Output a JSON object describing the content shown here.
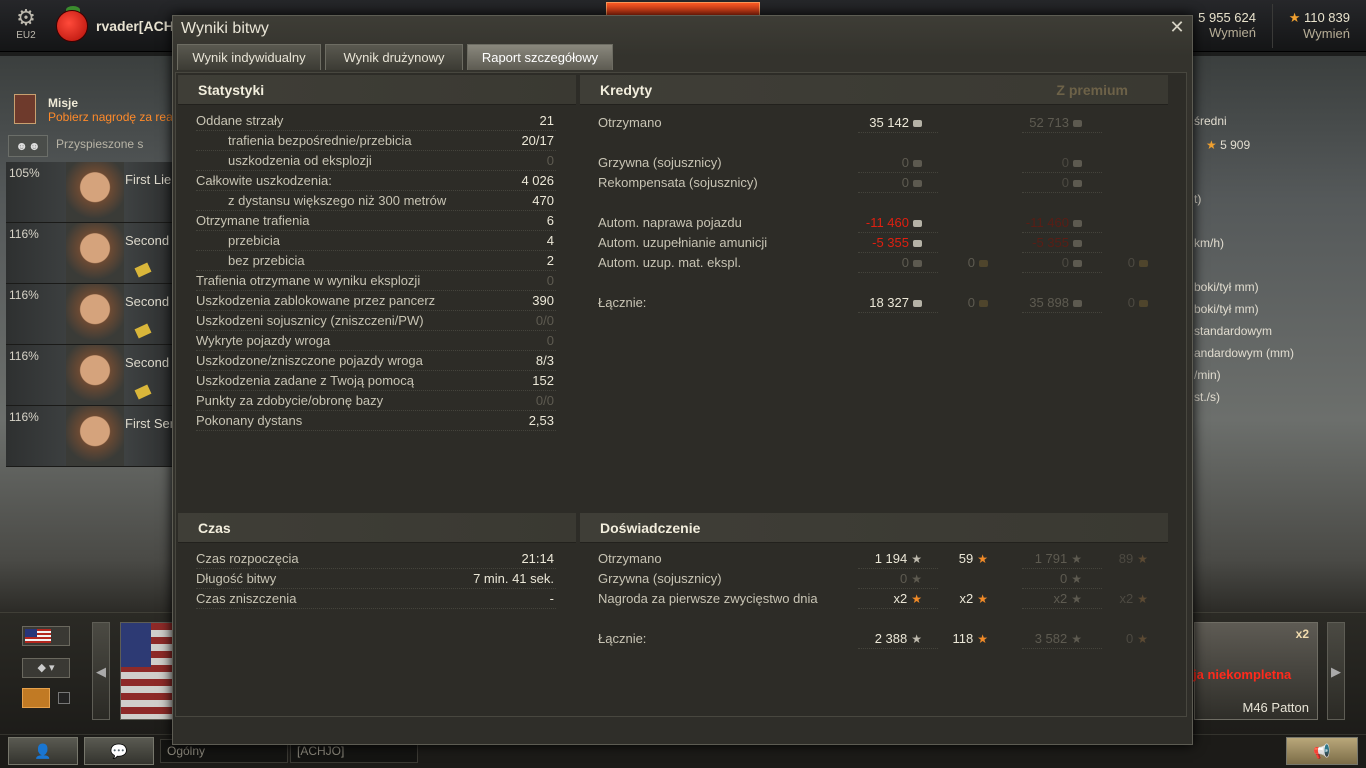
{
  "topbar": {
    "server": "EU2",
    "player": "rvader[ACHJ",
    "credits": "5 955 624",
    "credits_link": "Wymień",
    "freexp": "110 839",
    "freexp_link": "Wymień",
    "freexp_icon": "star-icon"
  },
  "missions": {
    "title": "Misje",
    "subtitle": "Pobierz nagrodę za real"
  },
  "crew_header": {
    "boost_label": "Przyspieszone s"
  },
  "crew": [
    {
      "pct": "105%",
      "rank": "First Lie"
    },
    {
      "pct": "116%",
      "rank": "Second"
    },
    {
      "pct": "116%",
      "rank": "Second"
    },
    {
      "pct": "116%",
      "rank": "Second"
    },
    {
      "pct": "116%",
      "rank": "First Ser"
    }
  ],
  "right_side": {
    "lines": [
      "średni",
      "5 909",
      "t)",
      "km/h)",
      "boki/tył mm)",
      "boki/tył mm)",
      "standardowym",
      "andardowym (mm)",
      "/min)",
      "st./s)"
    ]
  },
  "tank_right": {
    "badge": "x2",
    "warning": "ja niekompletna",
    "name": "M46 Patton"
  },
  "chat": {
    "channel1": "Ogólny",
    "channel2": "[ACHJO]"
  },
  "dialog": {
    "title": "Wyniki bitwy",
    "tabs": [
      "Wynik indywidualny",
      "Wynik drużynowy",
      "Raport szczegółowy"
    ],
    "active_tab": 2
  },
  "stats": {
    "title": "Statystyki",
    "rows": [
      {
        "label": "Oddane strzały",
        "value": "21",
        "indent": false,
        "dim": false
      },
      {
        "label": "trafienia bezpośrednie/przebicia",
        "value": "20/17",
        "indent": true,
        "dim": false
      },
      {
        "label": "uszkodzenia od eksplozji",
        "value": "0",
        "indent": true,
        "dim": true
      },
      {
        "label": "Całkowite uszkodzenia:",
        "value": "4 026",
        "indent": false,
        "dim": false
      },
      {
        "label": "z dystansu większego niż 300 metrów",
        "value": "470",
        "indent": true,
        "dim": false
      },
      {
        "label": "Otrzymane trafienia",
        "value": "6",
        "indent": false,
        "dim": false
      },
      {
        "label": "przebicia",
        "value": "4",
        "indent": true,
        "dim": false
      },
      {
        "label": "bez przebicia",
        "value": "2",
        "indent": true,
        "dim": false
      },
      {
        "label": "Trafienia otrzymane w wyniku eksplozji",
        "value": "0",
        "indent": false,
        "dim": true
      },
      {
        "label": "Uszkodzenia zablokowane przez pancerz",
        "value": "390",
        "indent": false,
        "dim": false
      },
      {
        "label": "Uszkodzeni sojusznicy (zniszczeni/PW)",
        "value": "0/0",
        "indent": false,
        "dim": true
      },
      {
        "label": "Wykryte pojazdy wroga",
        "value": "0",
        "indent": false,
        "dim": true
      },
      {
        "label": "Uszkodzone/zniszczone pojazdy wroga",
        "value": "8/3",
        "indent": false,
        "dim": false
      },
      {
        "label": "Uszkodzenia zadane z Twoją pomocą",
        "value": "152",
        "indent": false,
        "dim": false
      },
      {
        "label": "Punkty za zdobycie/obronę bazy",
        "value": "0/0",
        "indent": false,
        "dim": true
      },
      {
        "label": "Pokonany dystans",
        "value": "2,53",
        "indent": false,
        "dim": false
      }
    ]
  },
  "credits": {
    "title": "Kredyty",
    "premium_title": "Z premium",
    "rows": [
      {
        "label": "Otrzymano",
        "c1": "35 142",
        "c2": "",
        "p1": "52 713",
        "p2": "",
        "style": "normal"
      },
      {
        "label": "Grzywna (sojusznicy)",
        "c1": "0",
        "c2": "",
        "p1": "0",
        "p2": "",
        "style": "dim"
      },
      {
        "label": "Rekompensata (sojusznicy)",
        "c1": "0",
        "c2": "",
        "p1": "0",
        "p2": "",
        "style": "dim"
      },
      {
        "label": "Autom. naprawa pojazdu",
        "c1": "-11 460",
        "c2": "",
        "p1": "-11 460",
        "p2": "",
        "style": "red"
      },
      {
        "label": "Autom. uzupełnianie amunicji",
        "c1": "-5 355",
        "c2": "",
        "p1": "-5 355",
        "p2": "",
        "style": "red"
      },
      {
        "label": "Autom. uzup. mat. ekspl.",
        "c1": "0",
        "c2": "0",
        "p1": "0",
        "p2": "0",
        "style": "dim"
      },
      {
        "label": "Łącznie:",
        "c1": "18 327",
        "c2": "0",
        "p1": "35 898",
        "p2": "0",
        "style": "total"
      }
    ]
  },
  "time": {
    "title": "Czas",
    "rows": [
      {
        "label": "Czas rozpoczęcia",
        "value": "21:14"
      },
      {
        "label": "Długość bitwy",
        "value": "7 min. 41 sek."
      },
      {
        "label": "Czas zniszczenia",
        "value": "-"
      }
    ]
  },
  "experience": {
    "title": "Doświadczenie",
    "rows": [
      {
        "label": "Otrzymano",
        "c1": "1 194",
        "c2": "59",
        "p1": "1 791",
        "p2": "89",
        "style": "normal"
      },
      {
        "label": "Grzywna (sojusznicy)",
        "c1": "0",
        "c2": "",
        "p1": "0",
        "p2": "",
        "style": "dim"
      },
      {
        "label": "Nagroda za pierwsze zwycięstwo dnia",
        "c1": "x2",
        "c2": "x2",
        "p1": "x2",
        "p2": "x2",
        "style": "mult"
      },
      {
        "label": "Łącznie:",
        "c1": "2 388",
        "c2": "118",
        "p1": "3 582",
        "p2": "0",
        "style": "total"
      }
    ]
  }
}
